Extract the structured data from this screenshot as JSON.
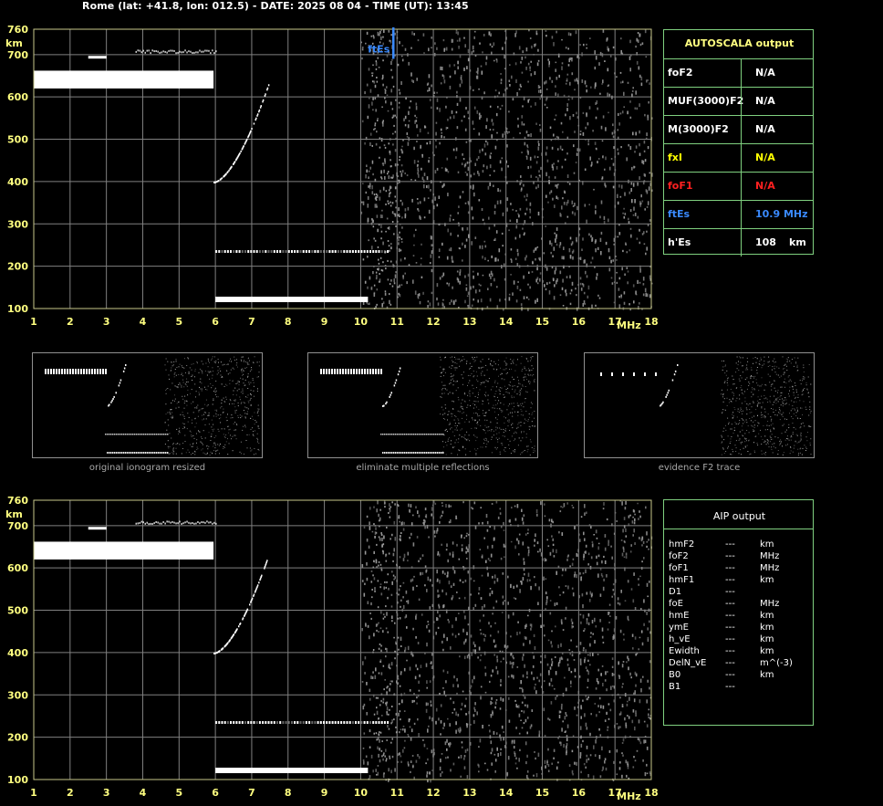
{
  "header": "Rome (lat: +41.8, lon: 012.5) - DATE: 2025 08 04 - TIME (UT): 13:45",
  "colors": {
    "grid": "#808080",
    "frame": "#c8c88a",
    "axis_text": "#ffff80",
    "panel_border": "#7fd07f",
    "fxl": "#ffff00",
    "foF1": "#ff2020",
    "ftEs": "#3a8aff",
    "trace": "#ffffff",
    "noise": "#9a9a9a"
  },
  "ionogram": {
    "y_unit": "km",
    "x_unit": "MHz",
    "y_ticks": [
      "760",
      "700",
      "600",
      "500",
      "400",
      "300",
      "200",
      "100"
    ],
    "x_ticks": [
      "1",
      "2",
      "3",
      "4",
      "5",
      "6",
      "7",
      "8",
      "9",
      "10",
      "11",
      "12",
      "13",
      "14",
      "15",
      "16",
      "17",
      "18"
    ],
    "ftEs_marker": "ftEs"
  },
  "autoscala": {
    "title": "AUTOSCALA output",
    "rows": [
      {
        "key": "foF2",
        "value": "N/A",
        "unit": "",
        "color": "#ffffff"
      },
      {
        "key": "MUF(3000)F2",
        "value": "N/A",
        "unit": "",
        "color": "#ffffff"
      },
      {
        "key": "M(3000)F2",
        "value": "N/A",
        "unit": "",
        "color": "#ffffff"
      },
      {
        "key": "fxI",
        "value": "N/A",
        "unit": "",
        "color": "#ffff00"
      },
      {
        "key": "foF1",
        "value": "N/A",
        "unit": "",
        "color": "#ff2020"
      },
      {
        "key": "ftEs",
        "value": "10.9 MHz",
        "unit": "",
        "color": "#3a8aff"
      },
      {
        "key": "h'Es",
        "value": "108",
        "unit": "km",
        "color": "#ffffff"
      }
    ]
  },
  "thumbnails": [
    {
      "caption": "original ionogram resized"
    },
    {
      "caption": "eliminate multiple reflections"
    },
    {
      "caption": "evidence F2 trace"
    }
  ],
  "aip": {
    "title": "AIP output",
    "rows": [
      {
        "key": "hmF2",
        "value": "---",
        "unit": "km"
      },
      {
        "key": "foF2",
        "value": "---",
        "unit": "MHz"
      },
      {
        "key": "foF1",
        "value": "---",
        "unit": "MHz"
      },
      {
        "key": "hmF1",
        "value": "---",
        "unit": "km"
      },
      {
        "key": "D1",
        "value": "---",
        "unit": ""
      },
      {
        "key": "foE",
        "value": "---",
        "unit": "MHz"
      },
      {
        "key": "hmE",
        "value": "---",
        "unit": "km"
      },
      {
        "key": "ymE",
        "value": "---",
        "unit": "km"
      },
      {
        "key": "h_vE",
        "value": "---",
        "unit": "km"
      },
      {
        "key": "Ewidth",
        "value": "---",
        "unit": "km"
      },
      {
        "key": "DelN_vE",
        "value": "---",
        "unit": "m^(-3)"
      },
      {
        "key": "B0",
        "value": "---",
        "unit": "km"
      },
      {
        "key": "B1",
        "value": "---",
        "unit": ""
      }
    ]
  }
}
